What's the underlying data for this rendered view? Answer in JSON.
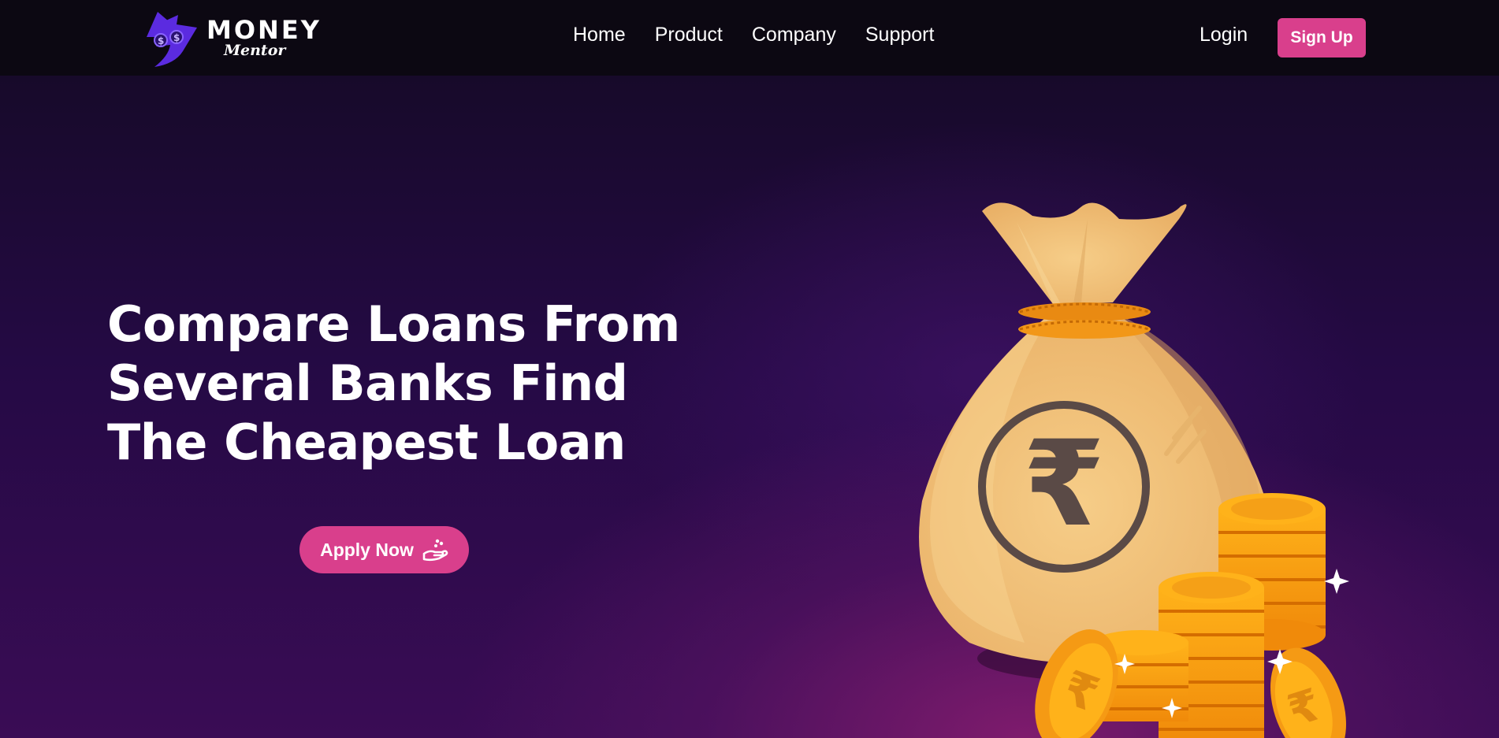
{
  "brand": {
    "name": "MONEY",
    "tagline": "Mentor"
  },
  "nav": {
    "links": [
      {
        "label": "Home"
      },
      {
        "label": "Product"
      },
      {
        "label": "Company"
      },
      {
        "label": "Support"
      }
    ],
    "login_label": "Login",
    "signup_label": "Sign Up"
  },
  "hero": {
    "title": "Compare Loans From Several Banks Find The Cheapest Loan",
    "cta_label": "Apply Now",
    "cta_icon": "hand-coins-icon",
    "illustration": "money-bag-with-rupee-coins",
    "illustration_symbol": "₹"
  },
  "colors": {
    "accent": "#d93f8c",
    "navbar_bg": "#0c0812",
    "hero_bg_top": "#170a2a",
    "hero_bg_bottom": "#3a0c55",
    "bag": "#f3c27a",
    "coin": "#f7a21b",
    "logo_purple": "#5b2be0"
  }
}
